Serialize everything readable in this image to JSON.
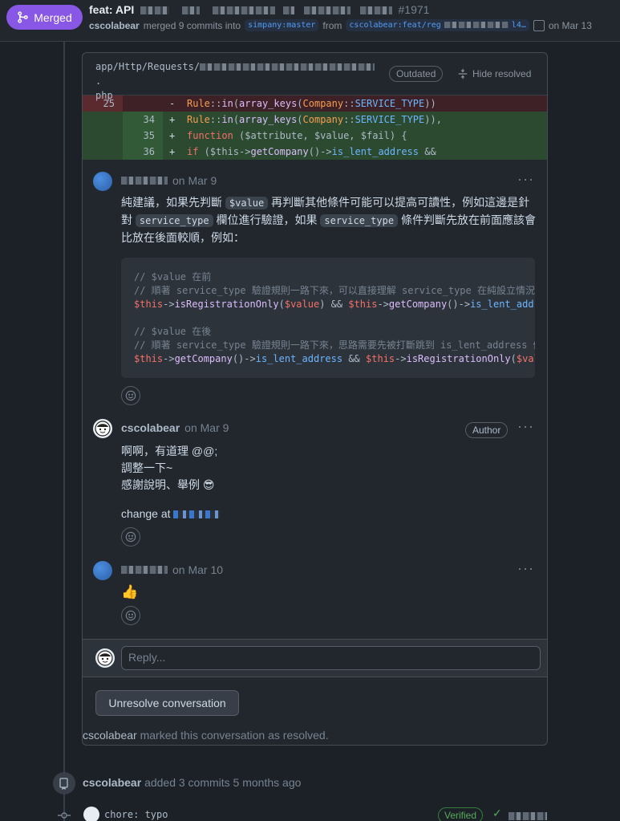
{
  "header": {
    "badge_label": "Merged",
    "title_prefix": "feat: API",
    "pr_number": "#1971",
    "author": "cscolabear",
    "merged_text": "merged 9 commits into",
    "base_branch": "simpany:master",
    "from_text": "from",
    "head_branch_prefix": "cscolabear:feat/reg",
    "head_branch_suffix": "l4…",
    "date_text": "on Mar 13"
  },
  "thread": {
    "file_path_prefix": "app/Http/Requests/",
    "file_path_suffix": "php",
    "outdated_label": "Outdated",
    "hide_resolved_label": "Hide resolved",
    "diff": [
      {
        "type": "del",
        "old": "25",
        "new": "",
        "sign": "-"
      },
      {
        "type": "add",
        "old": "",
        "new": "34",
        "sign": "+"
      },
      {
        "type": "add",
        "old": "",
        "new": "35",
        "sign": "+"
      },
      {
        "type": "add",
        "old": "",
        "new": "36",
        "sign": "+"
      }
    ],
    "comments": [
      {
        "author": "",
        "date": "on Mar 9",
        "body_1": "純建議，如果先判斷",
        "code_1": "$value",
        "body_2": "再判斷其他條件可能可以提高可讀性，例如這邊是針",
        "body_3": "對",
        "code_2": "service_type",
        "body_4": "欄位進行驗證，如果",
        "code_3": "service_type",
        "body_5": "條件判斷先放在前面應該會",
        "body_6": "比放在後面較順，例如：",
        "code_block": {
          "line1": "// $value 在前",
          "line2": "// 順著 service_type 驗證規則一路下來，可以直接理解 service_type 在純設立情況下",
          "line4": "// $value 在後",
          "line5": "// 順著 service_type 驗證規則一路下來，思路需要先被打斷跳到 is_lent_address 條"
        }
      },
      {
        "author": "cscolabear",
        "date": "on Mar 9",
        "badge": "Author",
        "line1": "啊啊，有道理 @@;",
        "line2": "調整一下~",
        "line3": "感謝說明、舉例 😎",
        "line4": "change at"
      },
      {
        "author": "",
        "date": "on Mar 10",
        "body": "👍"
      }
    ],
    "reply_placeholder": "Reply...",
    "unresolve_label": "Unresolve conversation",
    "resolved_user": "cscolabear",
    "resolved_text": "marked this conversation as resolved."
  },
  "timeline": {
    "user": "cscolabear",
    "text": "added 3 commits 5 months ago",
    "commit_msg": "chore: typo",
    "verified_label": "Verified"
  }
}
